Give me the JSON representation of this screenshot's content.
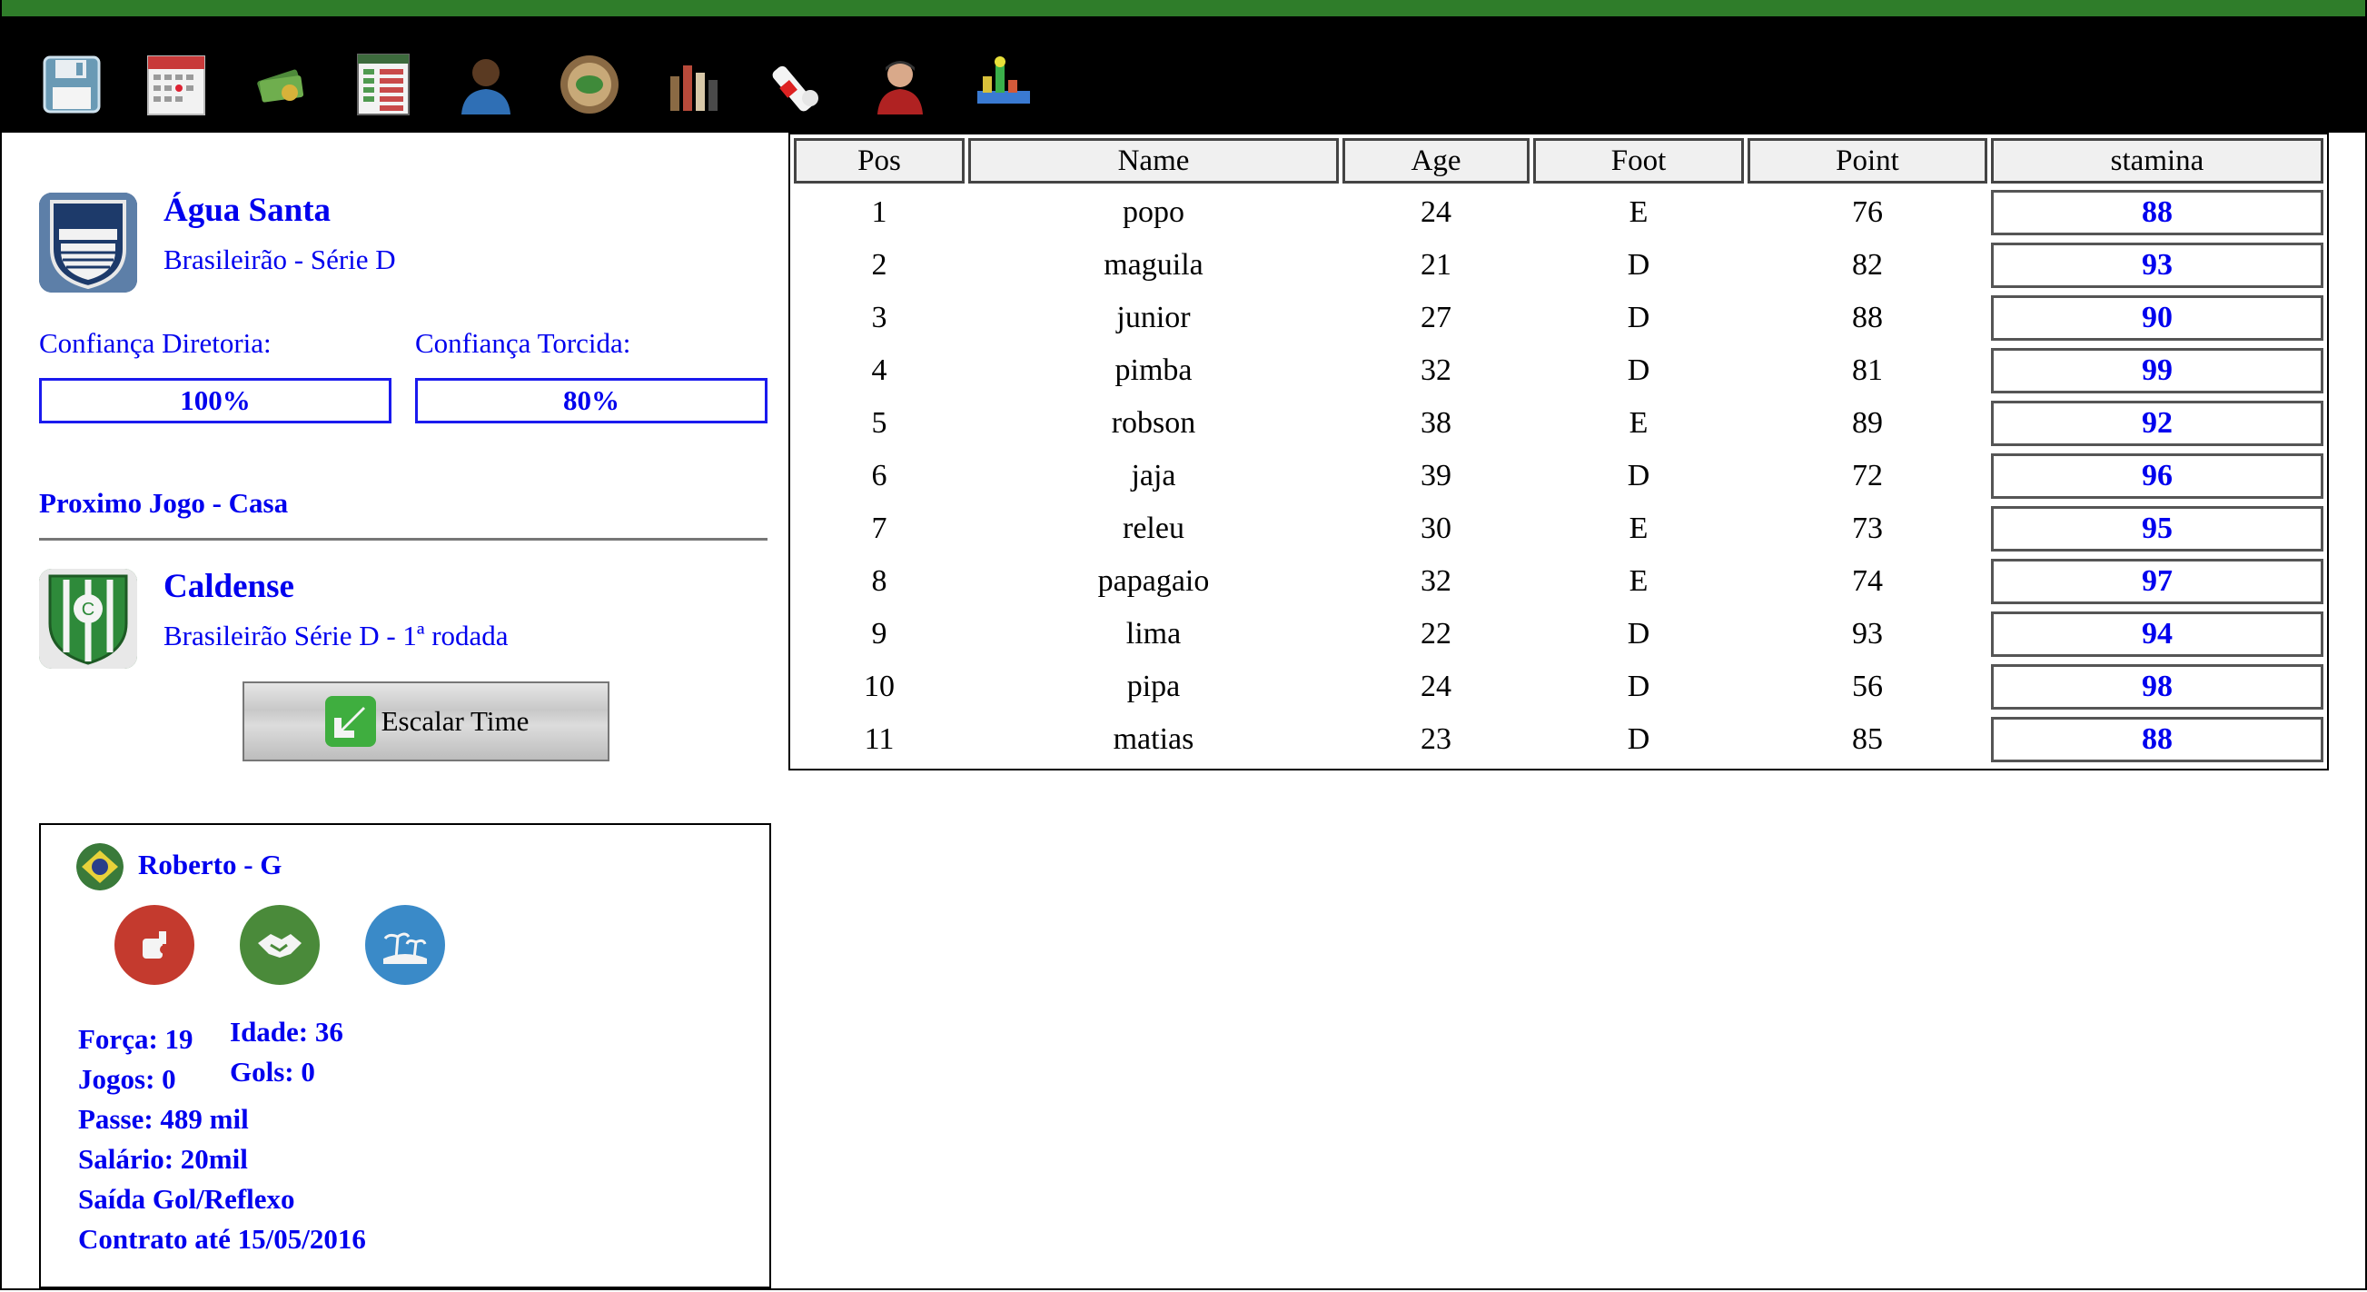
{
  "toolbar": {
    "icons": [
      "save-icon",
      "calendar-icon",
      "money-icon",
      "spreadsheet-icon",
      "person-icon",
      "stadium-icon",
      "trophies-icon",
      "medical-icon",
      "coach-icon",
      "stats-chart-icon"
    ]
  },
  "club": {
    "name": "Água Santa",
    "league": "Brasileirão - Série D"
  },
  "confidence": {
    "board_label": "Confiança Diretoria:",
    "board_value": "100%",
    "fans_label": "Confiança Torcida:",
    "fans_value": "80%",
    "board_level_pct": 100,
    "fans_level_pct": 80
  },
  "next_match": {
    "heading": "Proximo Jogo - Casa",
    "opponent": "Caldense",
    "competition": "Brasileirão Série D - 1ª rodada",
    "button_label": "Escalar Time"
  },
  "table": {
    "headers": [
      "Pos",
      "Name",
      "Age",
      "Foot",
      "Point",
      "stamina"
    ],
    "rows": [
      {
        "pos": "1",
        "name": "popo",
        "age": "24",
        "foot": "E",
        "point": "76",
        "stamina": "88"
      },
      {
        "pos": "2",
        "name": "maguila",
        "age": "21",
        "foot": "D",
        "point": "82",
        "stamina": "93"
      },
      {
        "pos": "3",
        "name": "junior",
        "age": "27",
        "foot": "D",
        "point": "88",
        "stamina": "90"
      },
      {
        "pos": "4",
        "name": "pimba",
        "age": "32",
        "foot": "D",
        "point": "81",
        "stamina": "99"
      },
      {
        "pos": "5",
        "name": "robson",
        "age": "38",
        "foot": "E",
        "point": "89",
        "stamina": "92"
      },
      {
        "pos": "6",
        "name": "jaja",
        "age": "39",
        "foot": "D",
        "point": "72",
        "stamina": "96"
      },
      {
        "pos": "7",
        "name": "releu",
        "age": "30",
        "foot": "E",
        "point": "73",
        "stamina": "95"
      },
      {
        "pos": "8",
        "name": "papagaio",
        "age": "32",
        "foot": "E",
        "point": "74",
        "stamina": "97"
      },
      {
        "pos": "9",
        "name": "lima",
        "age": "22",
        "foot": "D",
        "point": "93",
        "stamina": "94"
      },
      {
        "pos": "10",
        "name": "pipa",
        "age": "24",
        "foot": "D",
        "point": "56",
        "stamina": "98"
      },
      {
        "pos": "11",
        "name": "matias",
        "age": "23",
        "foot": "D",
        "point": "85",
        "stamina": "88"
      }
    ]
  },
  "player": {
    "name": "Roberto - G",
    "forca": "Força: 19",
    "idade": "Idade: 36",
    "jogos": "Jogos: 0",
    "gols": "Gols: 0",
    "passe": "Passe: 489 mil",
    "salario": "Salário: 20mil",
    "skill": "Saída Gol/Reflexo",
    "contrato": "Contrato até 15/05/2016"
  },
  "colors": {
    "link_blue": "#0000ee",
    "top_strip": "#2f7d2a",
    "toolbar_bg": "#000000"
  }
}
